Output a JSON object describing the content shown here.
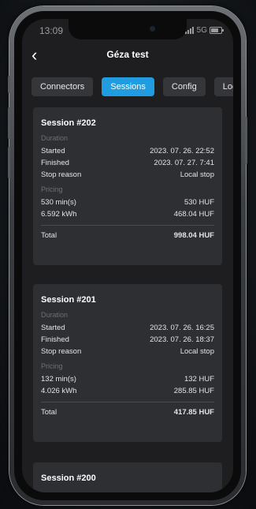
{
  "status_bar": {
    "time": "13:09",
    "network": "5G"
  },
  "header": {
    "title": "Géza test"
  },
  "tabs": [
    {
      "label": "Connectors"
    },
    {
      "label": "Sessions",
      "active": true
    },
    {
      "label": "Config"
    },
    {
      "label": "Log"
    }
  ],
  "sessions": [
    {
      "title": "Session #202",
      "duration_label": "Duration",
      "started_label": "Started",
      "started": "2023. 07. 26. 22:52",
      "finished_label": "Finished",
      "finished": "2023. 07. 27. 7:41",
      "stop_reason_label": "Stop reason",
      "stop_reason": "Local stop",
      "pricing_label": "Pricing",
      "time_qty": "530 min(s)",
      "time_price": "530 HUF",
      "energy_qty": "6.592 kWh",
      "energy_price": "468.04 HUF",
      "total_label": "Total",
      "total": "998.04 HUF"
    },
    {
      "title": "Session #201",
      "duration_label": "Duration",
      "started_label": "Started",
      "started": "2023. 07. 26. 16:25",
      "finished_label": "Finished",
      "finished": "2023. 07. 26. 18:37",
      "stop_reason_label": "Stop reason",
      "stop_reason": "Local stop",
      "pricing_label": "Pricing",
      "time_qty": "132 min(s)",
      "time_price": "132 HUF",
      "energy_qty": "4.026 kWh",
      "energy_price": "285.85 HUF",
      "total_label": "Total",
      "total": "417.85 HUF"
    },
    {
      "title": "Session #200"
    }
  ]
}
